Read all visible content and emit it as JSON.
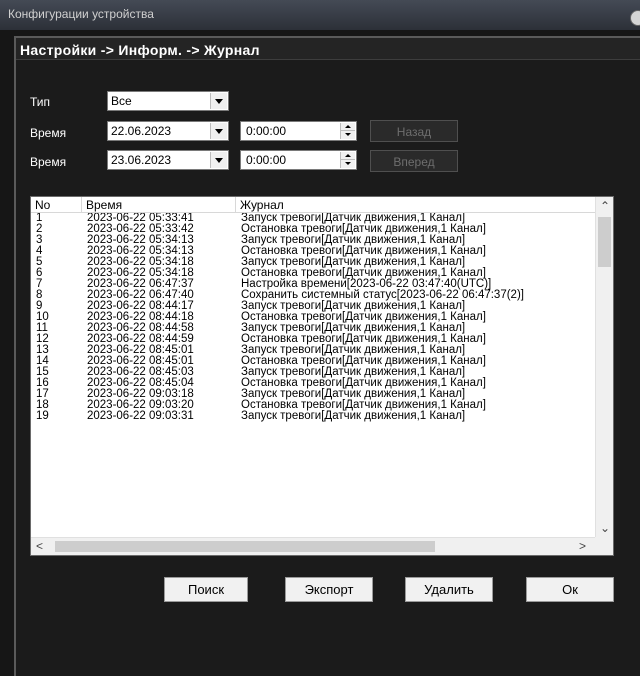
{
  "window": {
    "title": "Конфигурации устройства"
  },
  "breadcrumb": "Настройки -> Информ. -> Журнал",
  "filters": {
    "type_label": "Тип",
    "type_value": "Все",
    "time_label_1": "Время",
    "date_1": "22.06.2023",
    "time_1": "0:00:00",
    "time_label_2": "Время",
    "date_2": "23.06.2023",
    "time_2": "0:00:00",
    "back_label": "Назад",
    "forward_label": "Вперед"
  },
  "log": {
    "columns": [
      "No",
      "Время",
      "Журнал"
    ],
    "rows": [
      [
        "1",
        "2023-06-22 05:33:41",
        "Запуск тревоги[Датчик движения,1 Канал]"
      ],
      [
        "2",
        "2023-06-22 05:33:42",
        "Остановка тревоги[Датчик движения,1 Канал]"
      ],
      [
        "3",
        "2023-06-22 05:34:13",
        "Запуск тревоги[Датчик движения,1 Канал]"
      ],
      [
        "4",
        "2023-06-22 05:34:13",
        "Остановка тревоги[Датчик движения,1 Канал]"
      ],
      [
        "5",
        "2023-06-22 05:34:18",
        "Запуск тревоги[Датчик движения,1 Канал]"
      ],
      [
        "6",
        "2023-06-22 05:34:18",
        "Остановка тревоги[Датчик движения,1 Канал]"
      ],
      [
        "7",
        "2023-06-22 06:47:37",
        "Настройка времени[2023-06-22 03:47:40(UTC)]"
      ],
      [
        "8",
        "2023-06-22 06:47:40",
        "Сохранить системный статус[2023-06-22 06:47:37(2)]"
      ],
      [
        "9",
        "2023-06-22 08:44:17",
        "Запуск тревоги[Датчик движения,1 Канал]"
      ],
      [
        "10",
        "2023-06-22 08:44:18",
        "Остановка тревоги[Датчик движения,1 Канал]"
      ],
      [
        "11",
        "2023-06-22 08:44:58",
        "Запуск тревоги[Датчик движения,1 Канал]"
      ],
      [
        "12",
        "2023-06-22 08:44:59",
        "Остановка тревоги[Датчик движения,1 Канал]"
      ],
      [
        "13",
        "2023-06-22 08:45:01",
        "Запуск тревоги[Датчик движения,1 Канал]"
      ],
      [
        "14",
        "2023-06-22 08:45:01",
        "Остановка тревоги[Датчик движения,1 Канал]"
      ],
      [
        "15",
        "2023-06-22 08:45:03",
        "Запуск тревоги[Датчик движения,1 Канал]"
      ],
      [
        "16",
        "2023-06-22 08:45:04",
        "Остановка тревоги[Датчик движения,1 Канал]"
      ],
      [
        "17",
        "2023-06-22 09:03:18",
        "Запуск тревоги[Датчик движения,1 Канал]"
      ],
      [
        "18",
        "2023-06-22 09:03:20",
        "Остановка тревоги[Датчик движения,1 Канал]"
      ],
      [
        "19",
        "2023-06-22 09:03:31",
        "Запуск тревоги[Датчик движения,1 Канал]"
      ]
    ]
  },
  "buttons": {
    "search": "Поиск",
    "export": "Экспорт",
    "delete": "Удалить",
    "ok": "Ок"
  }
}
